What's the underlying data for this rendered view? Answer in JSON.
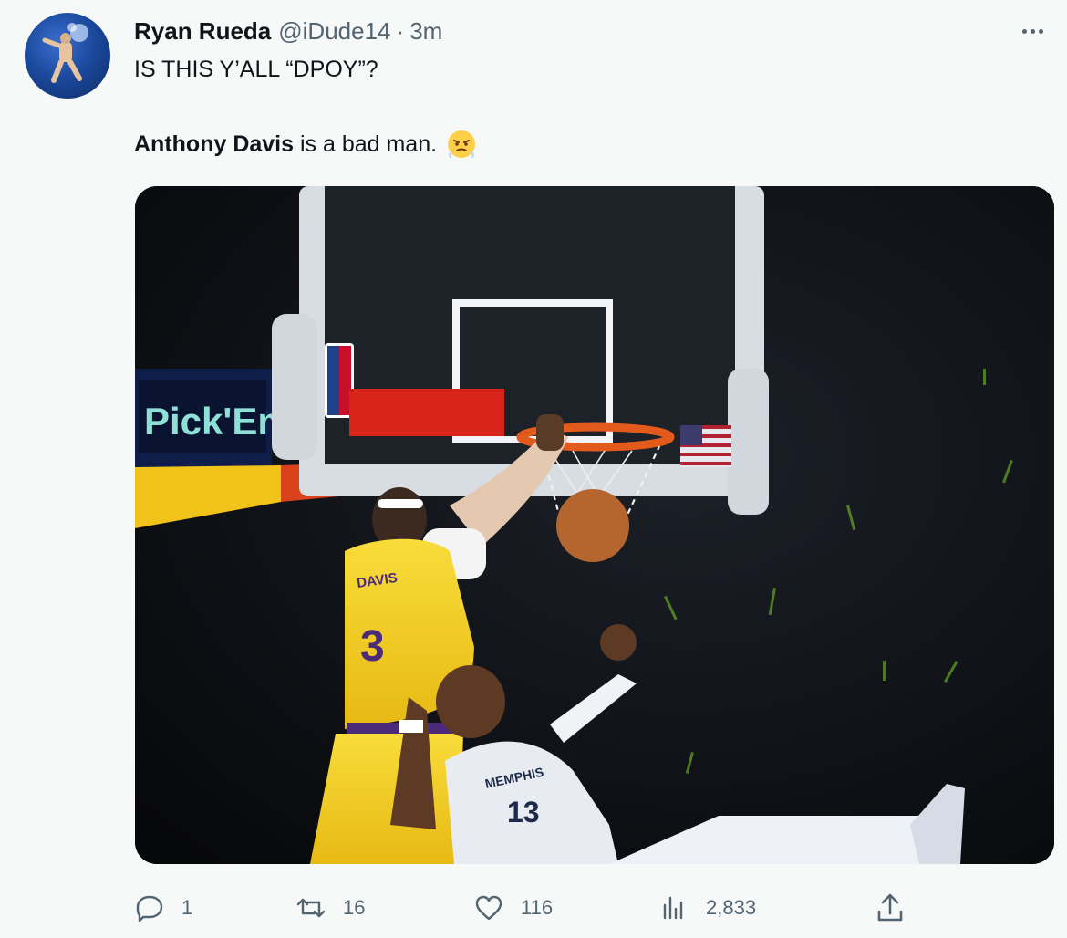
{
  "tweet": {
    "author_name": "Ryan Rueda",
    "author_handle": "@iDude14",
    "separator": "·",
    "time": "3m",
    "text_line1": "IS THIS Y’ALL “DPOY”?",
    "text_line2_bold": "Anthony Davis",
    "text_line2_rest": " is a bad man.",
    "emoji": "face-with-steam-from-nose",
    "media": {
      "scoreboard_text": "Pick'Em",
      "jersey_lakers": "3",
      "jersey_lakers_name": "DAVIS",
      "jersey_memphis": "13",
      "jersey_memphis_name": "MEMPHIS"
    }
  },
  "actions": {
    "reply_count": "1",
    "retweet_count": "16",
    "like_count": "116",
    "views_count": "2,833"
  },
  "colors": {
    "text_primary": "#0f1419",
    "text_secondary": "#536471",
    "background": "#f7f9f9",
    "lakers_gold": "#f5d12a",
    "memphis_white": "#e8ecf2"
  }
}
